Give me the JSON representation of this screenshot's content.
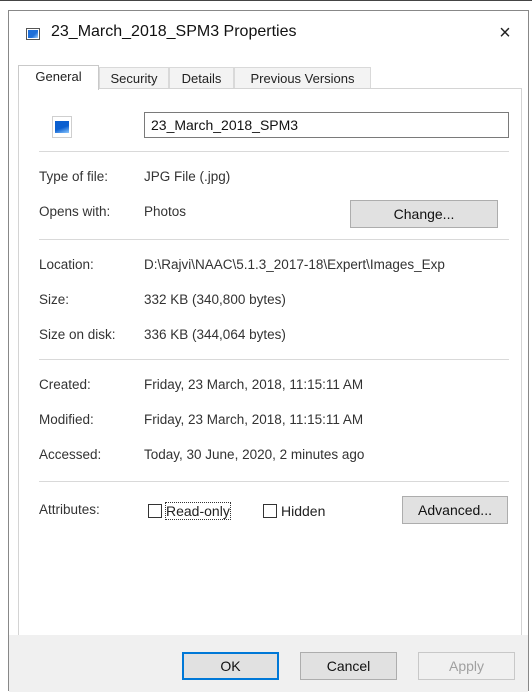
{
  "window": {
    "title": "23_March_2018_SPM3 Properties",
    "close_glyph": "×",
    "title_icon": "image-file-icon"
  },
  "tabs": [
    {
      "label": "General",
      "active": true
    },
    {
      "label": "Security",
      "active": false
    },
    {
      "label": "Details",
      "active": false
    },
    {
      "label": "Previous Versions",
      "active": false
    }
  ],
  "general": {
    "file_icon": "photo-file-icon",
    "file_name": "23_March_2018_SPM3",
    "type_of_file": {
      "label": "Type of file:",
      "value": "JPG File (.jpg)"
    },
    "opens_with": {
      "label": "Opens with:",
      "value": "Photos",
      "button": "Change..."
    },
    "location": {
      "label": "Location:",
      "value": "D:\\Rajvi\\NAAC\\5.1.3_2017-18\\Expert\\Images_Exp"
    },
    "size": {
      "label": "Size:",
      "value": "332 KB (340,800 bytes)"
    },
    "size_on_disk": {
      "label": "Size on disk:",
      "value": "336 KB (344,064 bytes)"
    },
    "created": {
      "label": "Created:",
      "value": "Friday, 23 March, 2018, 11:15:11 AM"
    },
    "modified": {
      "label": "Modified:",
      "value": "Friday, 23 March, 2018, 11:15:11 AM"
    },
    "accessed": {
      "label": "Accessed:",
      "value": "Today, 30 June, 2020, 2 minutes ago"
    },
    "attributes": {
      "label": "Attributes:",
      "read_only": {
        "label": "Read-only",
        "checked": false
      },
      "hidden": {
        "label": "Hidden",
        "checked": false
      },
      "advanced_button": "Advanced..."
    }
  },
  "footer": {
    "ok": "OK",
    "cancel": "Cancel",
    "apply": "Apply"
  },
  "colors": {
    "accent": "#0078d7",
    "disabled_text": "#a0a0a0"
  }
}
